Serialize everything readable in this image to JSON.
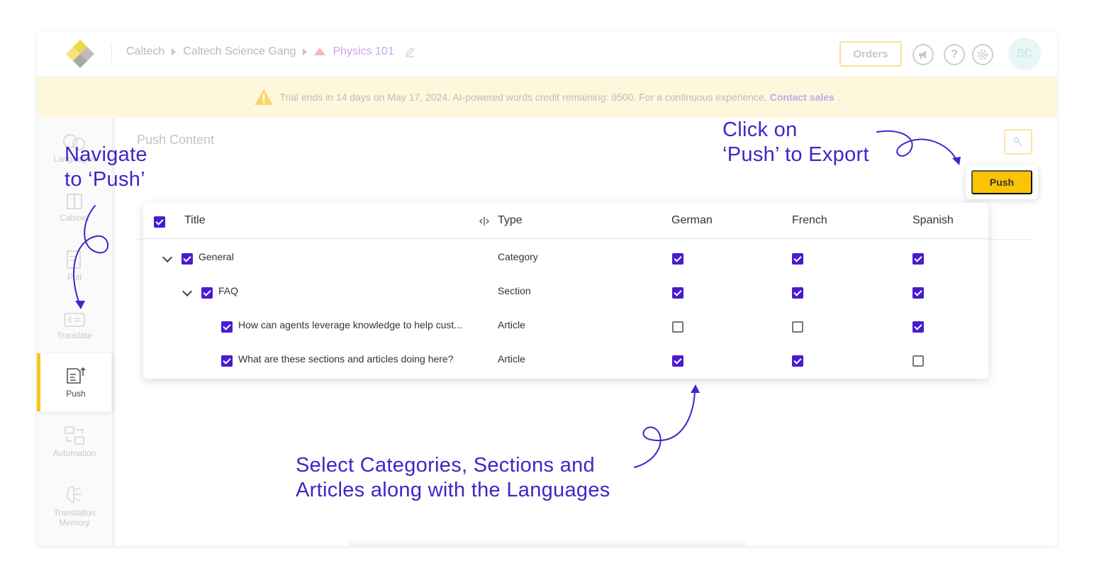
{
  "header": {
    "breadcrumb": [
      "Caltech",
      "Caltech Science Gang",
      "Physics 101"
    ],
    "orders_label": "Orders",
    "avatar_initials": "SC",
    "help_icon_glyph": "?"
  },
  "banner": {
    "text": "Trial ends in 14 days on May 17, 2024. AI-powered words credit remaining: 9500. For a continuous experience,",
    "link": "Contact sales",
    "suffix": "."
  },
  "sidebar": {
    "items": [
      {
        "label": "Languages",
        "icon": "languages-icon"
      },
      {
        "label": "Cabinet",
        "icon": "cabinet-icon"
      },
      {
        "label": "Pull",
        "icon": "pull-icon"
      },
      {
        "label": "Translate",
        "icon": "translate-icon"
      },
      {
        "label": "Push",
        "icon": "push-icon",
        "active": true
      },
      {
        "label": "Automation",
        "icon": "automation-icon"
      },
      {
        "label": "Translation Memory",
        "icon": "translation-memory-icon"
      }
    ]
  },
  "main": {
    "title": "Push Content",
    "push_label": "Push"
  },
  "table": {
    "columns": [
      "Title",
      "Type",
      "German",
      "French",
      "Spanish"
    ],
    "rows": [
      {
        "title": "General",
        "type": "Category",
        "checked": true,
        "german": true,
        "french": true,
        "spanish": true
      },
      {
        "title": "FAQ",
        "type": "Section",
        "checked": true,
        "german": true,
        "french": true,
        "spanish": true
      },
      {
        "title": "How can agents leverage knowledge to help cust...",
        "type": "Article",
        "checked": true,
        "german": false,
        "french": false,
        "spanish": true
      },
      {
        "title": "What are these sections and articles doing here?",
        "type": "Article",
        "checked": true,
        "german": true,
        "french": true,
        "spanish": false
      }
    ]
  },
  "annotations": {
    "navigate": [
      "Navigate",
      "to ‘Push’"
    ],
    "click_push": [
      "Click on",
      "‘Push’ to Export"
    ],
    "select": [
      "Select Categories, Sections and",
      "Articles along with the Languages"
    ]
  },
  "colors": {
    "accent_purple": "#4a1bd0",
    "annotation_purple": "#4025c9",
    "push_yellow": "#fbc403",
    "banner_bg": "#fdf7dc"
  }
}
